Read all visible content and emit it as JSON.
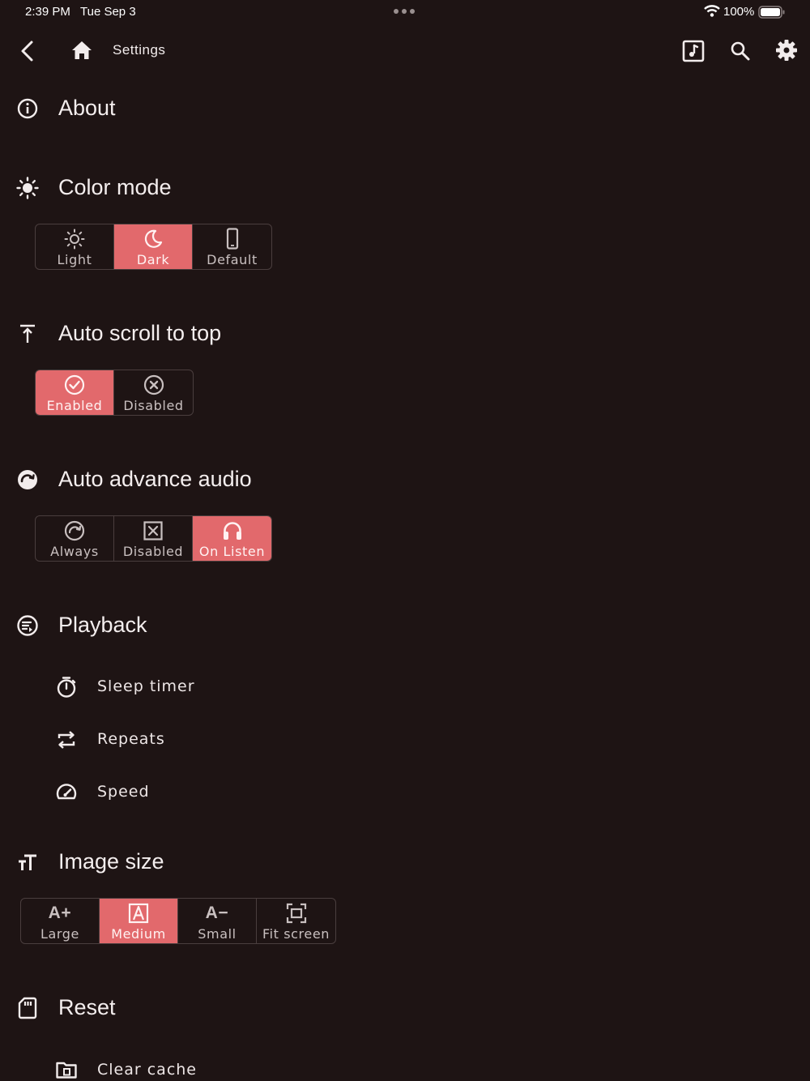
{
  "status_bar": {
    "time": "2:39 PM",
    "date": "Tue Sep 3",
    "battery": "100%"
  },
  "appbar": {
    "title": "Settings"
  },
  "sections": {
    "about": {
      "title": "About"
    },
    "color_mode": {
      "title": "Color mode",
      "options": [
        "Light",
        "Dark",
        "Default"
      ],
      "selected": "Dark"
    },
    "auto_scroll": {
      "title": "Auto scroll to top",
      "options": [
        "Enabled",
        "Disabled"
      ],
      "selected": "Enabled"
    },
    "auto_advance": {
      "title": "Auto advance audio",
      "options": [
        "Always",
        "Disabled",
        "On Listen"
      ],
      "selected": "On Listen"
    },
    "playback": {
      "title": "Playback",
      "items": [
        "Sleep timer",
        "Repeats",
        "Speed"
      ]
    },
    "image_size": {
      "title": "Image size",
      "options": [
        "Large",
        "Medium",
        "Small",
        "Fit screen"
      ],
      "selected": "Medium"
    },
    "reset": {
      "title": "Reset",
      "items": [
        "Clear cache"
      ]
    }
  },
  "colors": {
    "background": "#1e1414",
    "accent": "#e2696c",
    "text": "#f2ecec"
  }
}
